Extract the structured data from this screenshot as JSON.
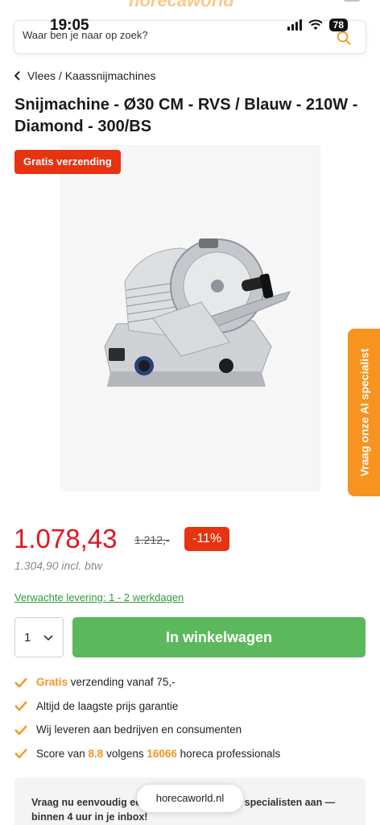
{
  "status_bar": {
    "time": "19:05",
    "battery": "78"
  },
  "header": {
    "logo_text": "horecaworld"
  },
  "search": {
    "placeholder": "Waar ben je naar op zoek?"
  },
  "breadcrumb": {
    "text": "Vlees / Kaassnijmachines"
  },
  "product": {
    "title": "Snijmachine - Ø30 CM - RVS / Blauw - 210W - Diamond - 300/BS",
    "shipping_badge": "Gratis verzending",
    "price": "1.078,43",
    "old_price": "1.212,-",
    "discount": "-11%",
    "price_incl": "1.304,90 incl. btw",
    "delivery": "Verwachte levering: 1 - 2 werkdagen",
    "quantity": "1",
    "cart_button": "In winkelwagen"
  },
  "side_tab": {
    "label": "Vraag onze AI specialist"
  },
  "usps": [
    {
      "highlight": "Gratis",
      "text": " verzending vanaf 75,-"
    },
    {
      "highlight": "",
      "text": "Altijd de laagste prijs garantie"
    },
    {
      "highlight": "",
      "text": "Wij leveren aan bedrijven en consumenten"
    },
    {
      "prefix": "Score van ",
      "score": "8.8",
      "middle": " volgens ",
      "count": "16066",
      "suffix": " horeca professionals"
    }
  ],
  "info_card": {
    "text": "Vraag nu eenvoudig een offerte aan bij onze specialisten aan — binnen 4 uur in je inbox!"
  },
  "browser": {
    "url": "horecaworld.nl"
  },
  "colors": {
    "accent_orange": "#f7931e",
    "price_red": "#e2141f",
    "badge_red": "#e63312",
    "cta_green": "#5cb85c",
    "link_green": "#2e9b3b"
  },
  "icons": [
    "hamburger-icon",
    "search-icon",
    "chevron-left-icon",
    "chevron-down-icon",
    "check-icon",
    "cart-icon"
  ]
}
